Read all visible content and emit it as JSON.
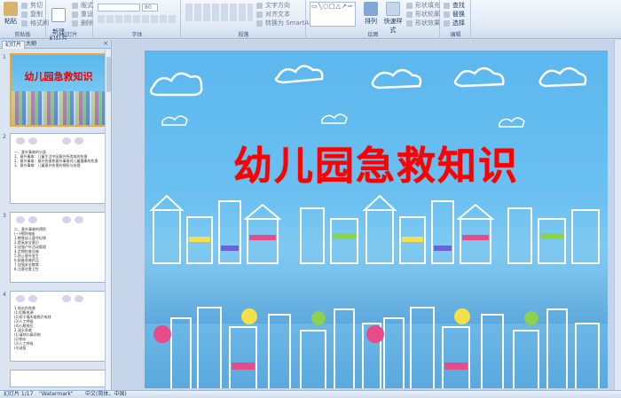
{
  "ribbon": {
    "clipboard": {
      "paste": "粘贴",
      "cut": "剪切",
      "copy": "复制",
      "format_painter": "格式刷",
      "label": "剪贴板"
    },
    "slides": {
      "new_slide": "新建\n幻灯片",
      "layout": "版式",
      "reset": "重设",
      "delete": "删除",
      "label": "幻灯片"
    },
    "font": {
      "size": "80",
      "label": "字体"
    },
    "paragraph": {
      "text_direction": "文字方向",
      "align_text": "对齐文本",
      "smartart": "转换为 SmartArt",
      "label": "段落"
    },
    "drawing": {
      "shapes_preview": "▭╲○□△↗⇨☆{}",
      "arrange": "排列",
      "quick_styles": "快速样式",
      "fill": "形状填充",
      "outline": "形状轮廓",
      "effects": "形状效果",
      "label": "绘图"
    },
    "editing": {
      "find": "查找",
      "replace": "替换",
      "select": "选择",
      "label": "编辑"
    }
  },
  "left_pane": {
    "tabs": [
      "幻灯片",
      "大纲"
    ],
    "close_icon": "×",
    "thumbnails": [
      {
        "num": "1",
        "title": "幼儿园急救知识"
      },
      {
        "num": "2",
        "lines": "一、意外事故的分类\n1、意外事故：儿童生活中因意外所造成的伤害\n2、意外事故：意外伤害和意外事故对儿童健康的危害\n3、意外事故：儿童意外伤害的预防与处理"
      },
      {
        "num": "3",
        "lines": "二、意外事故的预防\n(一)预防措施\n1.教育幼儿遵守纪律\n2.提高安全意识\n3.加强户外活动管理\n4.定期检查设施\n5.防止意外发生\n6.配备急救药品\n7.加强安全教育\n8.注意饮食卫生"
      },
      {
        "num": "4",
        "lines": "1.电击伤急救\n(1)切断电源\n(2)用干燥木棍挑开电线\n(3)人工呼吸\n(4)心脏按压\n2.溺水急救\n(1)清除口鼻异物\n(2)倒水\n(3)人工呼吸\n(4)送医"
      }
    ]
  },
  "slide": {
    "title": "幼儿园急救知识"
  },
  "status_bar": {
    "slide_info": "幻灯片 1/17",
    "theme": "\"Watermark\"",
    "language": "中文(简体，中国)"
  }
}
